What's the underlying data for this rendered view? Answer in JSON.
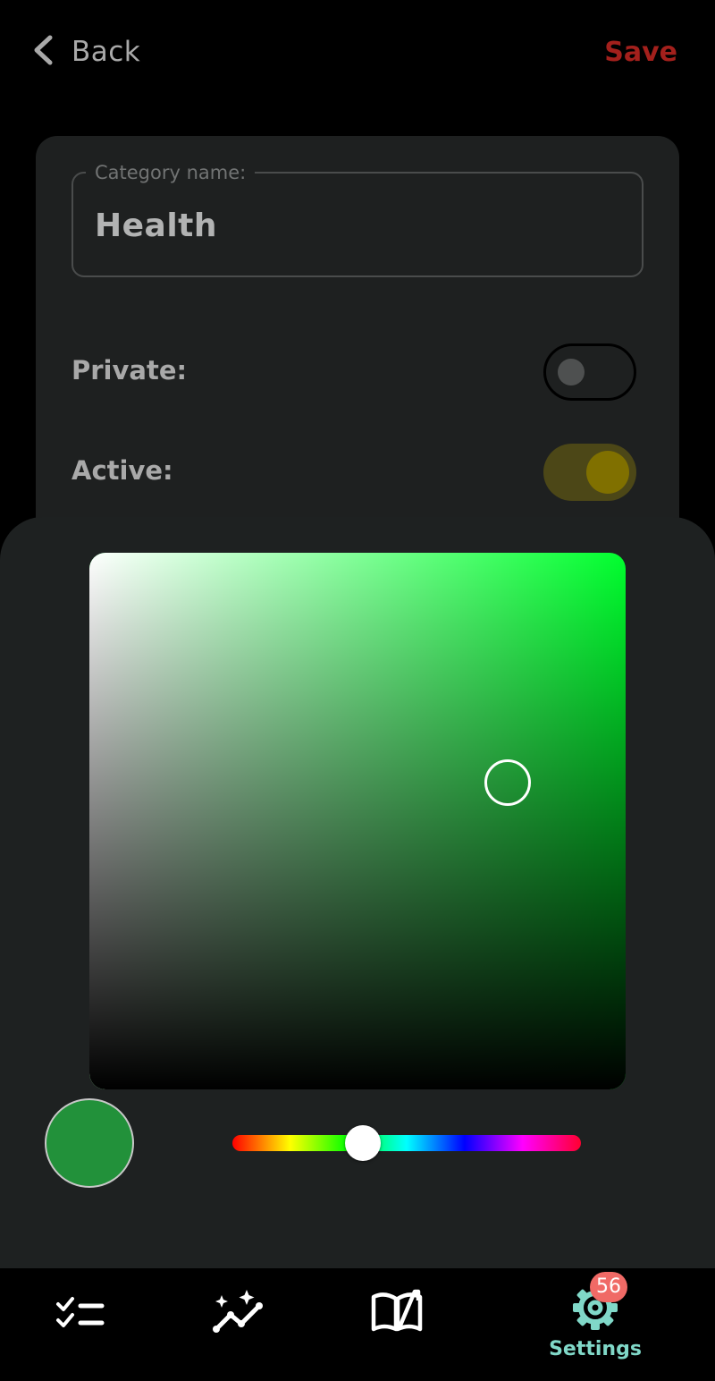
{
  "header": {
    "back_label": "Back",
    "save_label": "Save"
  },
  "form": {
    "category_legend": "Category name:",
    "category_value": "Health",
    "private_label": "Private:",
    "private_on": false,
    "active_label": "Active:",
    "active_on": true
  },
  "color_picker": {
    "selected_color": "#22913a",
    "hue_base_color": "#00ff2e",
    "hue_fraction": 0.37
  },
  "nav": {
    "items": [
      {
        "id": "tasks",
        "icon": "checklist-icon"
      },
      {
        "id": "stats",
        "icon": "sparkle-graph-icon"
      },
      {
        "id": "journal",
        "icon": "open-book-icon"
      },
      {
        "id": "settings",
        "icon": "gear-icon",
        "label": "Settings",
        "badge": "56",
        "active": true
      }
    ]
  },
  "colors": {
    "accent_save": "#a3201c",
    "accent_active_nav": "#80d8c8",
    "toggle_on": "#807000",
    "badge": "#f06a66"
  }
}
